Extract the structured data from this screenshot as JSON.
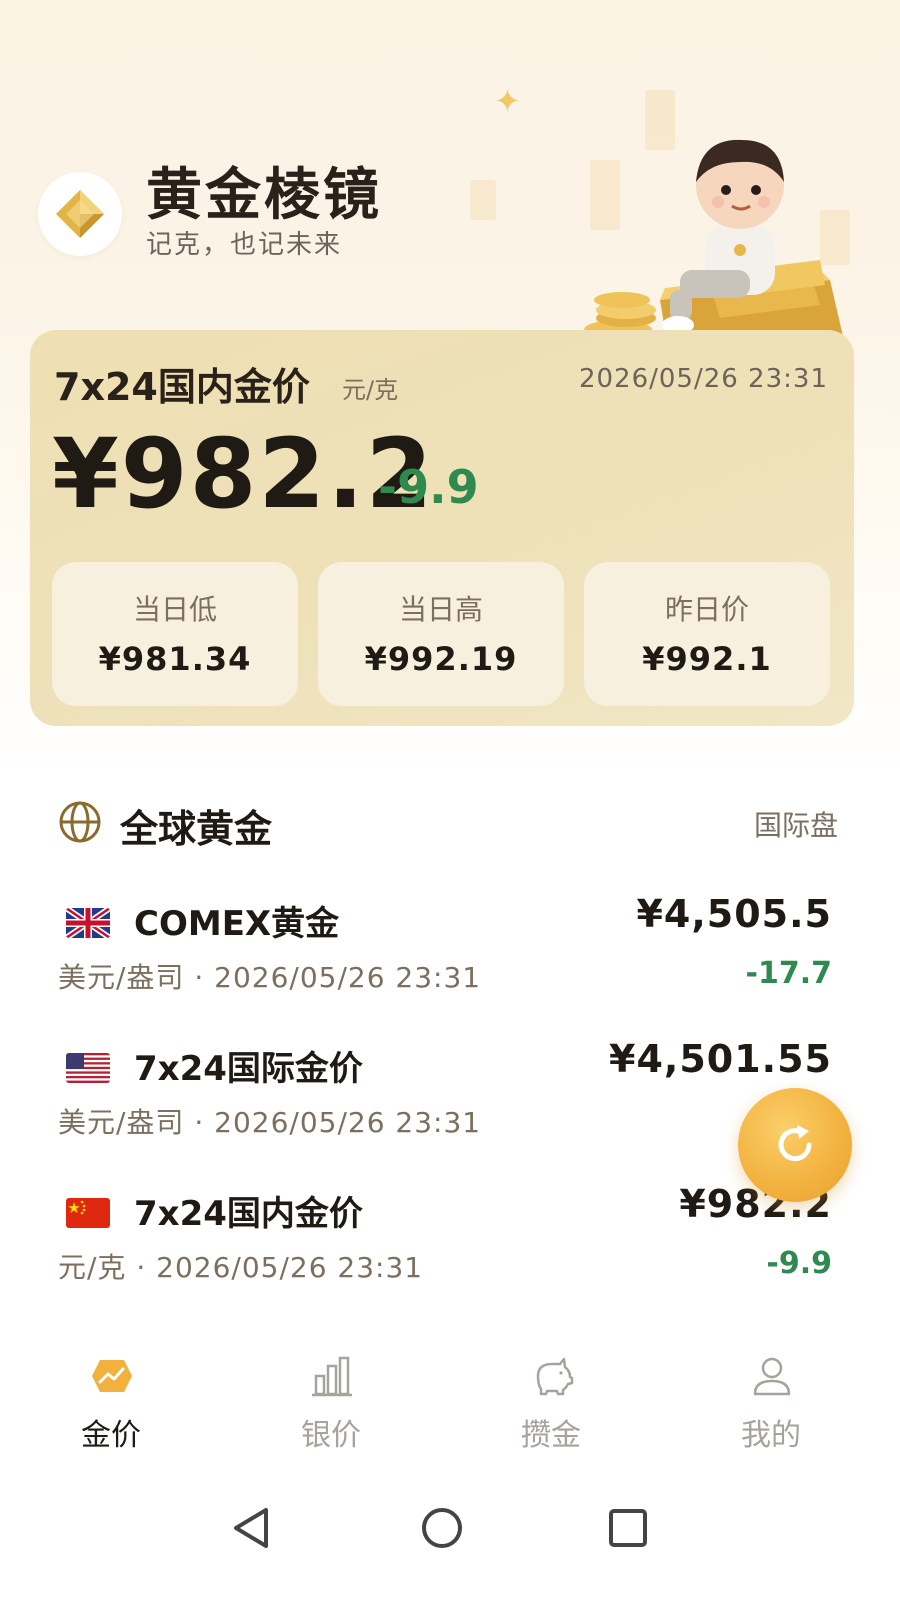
{
  "app": {
    "name": "黄金棱镜",
    "slogan": "记克，也记未来"
  },
  "domestic_card": {
    "title": "7x24国内金价",
    "unit": "元/克",
    "timestamp": "2026/05/26 23:31",
    "price": "¥982.2",
    "change": "-9.9",
    "stats": [
      {
        "label": "当日低",
        "value": "¥981.34"
      },
      {
        "label": "当日高",
        "value": "¥992.19"
      },
      {
        "label": "昨日价",
        "value": "¥992.1"
      }
    ]
  },
  "global_section": {
    "title": "全球黄金",
    "link": "国际盘",
    "icon": "globe-icon"
  },
  "markets": [
    {
      "name": "COMEX黄金",
      "meta": "美元/盎司 · 2026/05/26 23:31",
      "price": "¥4,505.5",
      "change": "-17.7",
      "flag": "uk-flag-icon"
    },
    {
      "name": "7x24国际金价",
      "meta": "美元/盎司 · 2026/05/26 23:31",
      "price": "¥4,501.55",
      "change": "-",
      "flag": "us-flag-icon"
    },
    {
      "name": "7x24国内金价",
      "meta": "元/克 · 2026/05/26 23:31",
      "price": "¥982.2",
      "change": "-9.9",
      "flag": "cn-flag-icon"
    }
  ],
  "tabs": [
    {
      "label": "金价",
      "icon": "gold-chart-icon",
      "active": true
    },
    {
      "label": "银价",
      "icon": "bar-chart-icon",
      "active": false
    },
    {
      "label": "攒金",
      "icon": "piggy-bank-icon",
      "active": false
    },
    {
      "label": "我的",
      "icon": "user-icon",
      "active": false
    }
  ],
  "colors": {
    "accent_gold": "#f2b13e",
    "card_bg": "#efe0b3",
    "down_green": "#2e8a4e",
    "text_primary": "#1f1a14"
  }
}
